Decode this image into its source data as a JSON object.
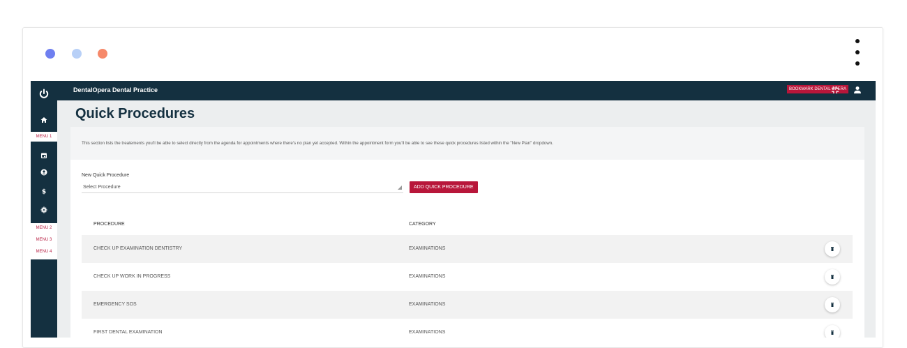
{
  "app": {
    "practice_name": "DentalOpera Dental Practice",
    "bookmark_label": "BOOKMARK DENTAL OPERA"
  },
  "sidebar": {
    "menu1": "MENU 1",
    "menu2": "MENU 2",
    "menu3": "MENU 3",
    "menu4": "MENU 4"
  },
  "page": {
    "title": "Quick Procedures",
    "description": "This section lists the treatements you'll be able to select directly from the agenda for appointments where there's no plan yet accepted. Within the appointment form you'll be able to see these quick procedures listed within the \"New Plan\" dropdown."
  },
  "form": {
    "label": "New Quick Procedure",
    "select_value": "Select Procedure",
    "add_button": "ADD QUICK PROCEDURE"
  },
  "table": {
    "headers": [
      "PROCEDURE",
      "CATEGORY"
    ],
    "rows": [
      {
        "procedure": "CHECK UP EXAMINATION DENTISTRY",
        "category": "EXAMINATIONS"
      },
      {
        "procedure": "CHECK UP WORK IN PROGRESS",
        "category": "EXAMINATIONS"
      },
      {
        "procedure": "EMERGENCY SOS",
        "category": "EXAMINATIONS"
      },
      {
        "procedure": "FIRST DENTAL EXAMINATION",
        "category": "EXAMINATIONS"
      }
    ]
  },
  "colors": {
    "dot1": "#6f7ff0",
    "dot2": "#b8d0f7",
    "dot3": "#f6896a",
    "navy": "#143040",
    "accent": "#b8163a"
  }
}
